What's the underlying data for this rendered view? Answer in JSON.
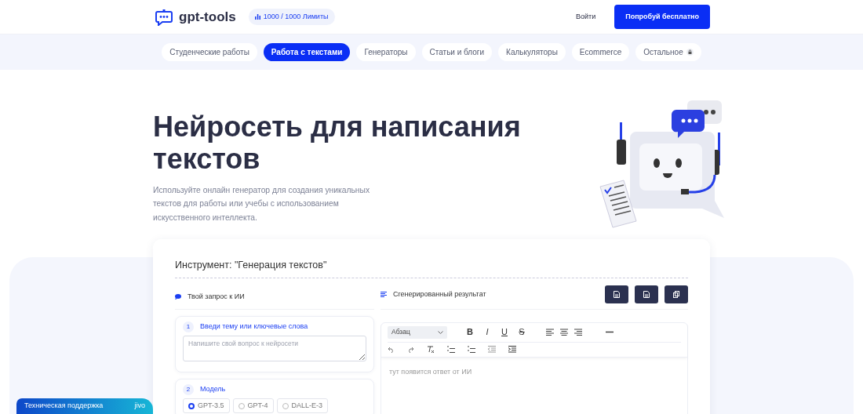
{
  "header": {
    "logo_text": "gpt-tools",
    "limits": "1000 / 1000 Лимиты",
    "login": "Войти",
    "cta": "Попробуй бесплатно"
  },
  "categories": [
    {
      "label": "Студенческие работы",
      "selected": false,
      "locked": false
    },
    {
      "label": "Работа с текстами",
      "selected": true,
      "locked": false
    },
    {
      "label": "Генераторы",
      "selected": false,
      "locked": false
    },
    {
      "label": "Статьи и блоги",
      "selected": false,
      "locked": false
    },
    {
      "label": "Калькуляторы",
      "selected": false,
      "locked": false
    },
    {
      "label": "Ecommerce",
      "selected": false,
      "locked": false
    },
    {
      "label": "Остальное",
      "selected": false,
      "locked": true
    }
  ],
  "hero": {
    "title": "Нейросеть для написания текстов",
    "description": "Используйте онлайн генератор для создания уникальных текстов для работы или учебы с использованием искусственного интеллекта."
  },
  "tool": {
    "title": "Инструмент: \"Генерация текстов\"",
    "input_heading": "Твой запрос к ИИ",
    "output_heading": "Сгенерированный результат",
    "prompt_step": {
      "number": "1",
      "label": "Введи тему или ключевые слова",
      "placeholder": "Напишите свой вопрос к нейросети"
    },
    "model_step": {
      "number": "2",
      "label": "Модель",
      "options": [
        {
          "label": "GPT-3.5",
          "selected": true
        },
        {
          "label": "GPT-4",
          "selected": false
        },
        {
          "label": "DALL-E-3",
          "selected": false
        }
      ]
    },
    "editor": {
      "block_format": "Абзац",
      "format_buttons": [
        {
          "label": "B",
          "kind": "bold"
        },
        {
          "label": "I",
          "kind": "italic"
        },
        {
          "label": "U",
          "kind": "underline"
        },
        {
          "label": "S",
          "kind": "strike"
        }
      ],
      "placeholder": "тут появится ответ от ИИ"
    }
  },
  "chat_widget": {
    "label": "Техническая поддержка",
    "brand": "jivo"
  }
}
